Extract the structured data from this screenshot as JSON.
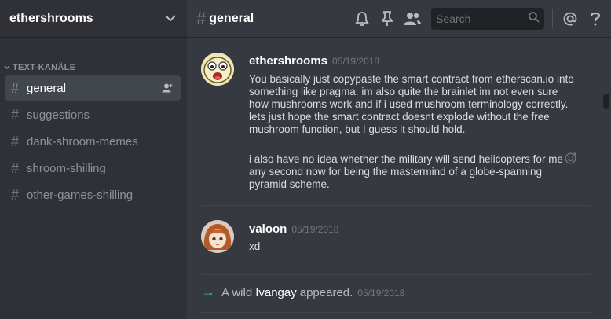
{
  "guild": {
    "name": "ethershrooms"
  },
  "category": {
    "label": "TEXT-KANÄLE"
  },
  "channels": [
    {
      "label": "general"
    },
    {
      "label": "suggestions"
    },
    {
      "label": "dank-shroom-memes"
    },
    {
      "label": "shroom-shilling"
    },
    {
      "label": "other-games-shilling"
    }
  ],
  "header": {
    "hash": "#",
    "title": "general"
  },
  "search": {
    "placeholder": "Search"
  },
  "messages": [
    {
      "author": "ethershrooms",
      "timestamp": "05/19/2018",
      "lines": [
        "You basically just copypaste the smart contract from etherscan.io into something like pragma. im also quite the brainlet im not even sure how mushrooms work and if i used mushroom terminology correctly. lets just hope the smart contract doesnt explode without the free mushroom function, but I guess it should hold.",
        "i also have no idea whether the military will send helicopters for me any second now for being the mastermind of a globe-spanning pyramid scheme."
      ]
    },
    {
      "author": "valoon",
      "timestamp": "05/19/2018",
      "lines": [
        "xd"
      ]
    }
  ],
  "join": {
    "prefix": "A wild",
    "name": "Ivangay",
    "suffix": "appeared.",
    "timestamp": "05/19/2018"
  },
  "colors": {
    "sidebar": "#2f3136",
    "chat": "#36393f",
    "accent_green": "#43b581"
  }
}
